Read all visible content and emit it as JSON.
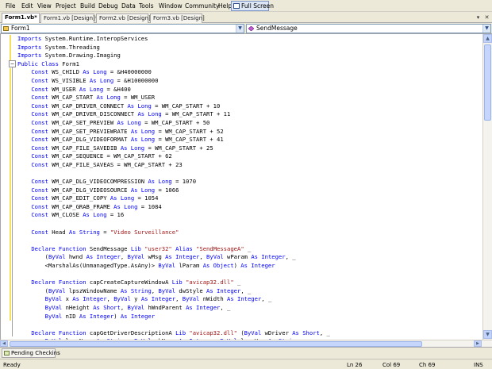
{
  "menu": [
    "File",
    "Edit",
    "View",
    "Project",
    "Build",
    "Debug",
    "Data",
    "Tools",
    "Window",
    "Community",
    "Help"
  ],
  "fullscreen_label": "Full Screen",
  "tabs": [
    {
      "label": "Form1.vb*",
      "active": true
    },
    {
      "label": "Form1.vb [Design]*",
      "active": false
    },
    {
      "label": "Form2.vb [Design]",
      "active": false
    },
    {
      "label": "Form3.vb [Design]",
      "active": false
    }
  ],
  "tab_controls": {
    "dropdown": "▾",
    "close": "✕"
  },
  "nav": {
    "class_combo": "Form1",
    "member_combo": "SendMessage"
  },
  "code_lines": [
    [
      [
        "kw",
        "Imports "
      ],
      [
        "pl",
        "System.Runtime.InteropServices"
      ]
    ],
    [
      [
        "kw",
        "Imports "
      ],
      [
        "pl",
        "System.Threading"
      ]
    ],
    [
      [
        "kw",
        "Imports "
      ],
      [
        "pl",
        "System.Drawing.Imaging"
      ]
    ],
    [
      [
        "kw",
        "Public Class "
      ],
      [
        "pl",
        "Form1"
      ]
    ],
    [
      [
        "pl",
        "    "
      ],
      [
        "kw",
        "Const "
      ],
      [
        "pl",
        "WS_CHILD "
      ],
      [
        "kw",
        "As Long "
      ],
      [
        "pl",
        "= &H40000000"
      ]
    ],
    [
      [
        "pl",
        "    "
      ],
      [
        "kw",
        "Const "
      ],
      [
        "pl",
        "WS_VISIBLE "
      ],
      [
        "kw",
        "As Long "
      ],
      [
        "pl",
        "= &H10000000"
      ]
    ],
    [
      [
        "pl",
        "    "
      ],
      [
        "kw",
        "Const "
      ],
      [
        "pl",
        "WM_USER "
      ],
      [
        "kw",
        "As Long "
      ],
      [
        "pl",
        "= &H400"
      ]
    ],
    [
      [
        "pl",
        "    "
      ],
      [
        "kw",
        "Const "
      ],
      [
        "pl",
        "WM_CAP_START "
      ],
      [
        "kw",
        "As Long "
      ],
      [
        "pl",
        "= WM_USER"
      ]
    ],
    [
      [
        "pl",
        "    "
      ],
      [
        "kw",
        "Const "
      ],
      [
        "pl",
        "WM_CAP_DRIVER_CONNECT "
      ],
      [
        "kw",
        "As Long "
      ],
      [
        "pl",
        "= WM_CAP_START + 10"
      ]
    ],
    [
      [
        "pl",
        "    "
      ],
      [
        "kw",
        "Const "
      ],
      [
        "pl",
        "WM_CAP_DRIVER_DISCONNECT "
      ],
      [
        "kw",
        "As Long "
      ],
      [
        "pl",
        "= WM_CAP_START + 11"
      ]
    ],
    [
      [
        "pl",
        "    "
      ],
      [
        "kw",
        "Const "
      ],
      [
        "pl",
        "WM_CAP_SET_PREVIEW "
      ],
      [
        "kw",
        "As Long "
      ],
      [
        "pl",
        "= WM_CAP_START + 50"
      ]
    ],
    [
      [
        "pl",
        "    "
      ],
      [
        "kw",
        "Const "
      ],
      [
        "pl",
        "WM_CAP_SET_PREVIEWRATE "
      ],
      [
        "kw",
        "As Long "
      ],
      [
        "pl",
        "= WM_CAP_START + 52"
      ]
    ],
    [
      [
        "pl",
        "    "
      ],
      [
        "kw",
        "Const "
      ],
      [
        "pl",
        "WM_CAP_DLG_VIDEOFORMAT "
      ],
      [
        "kw",
        "As Long "
      ],
      [
        "pl",
        "= WM_CAP_START + 41"
      ]
    ],
    [
      [
        "pl",
        "    "
      ],
      [
        "kw",
        "Const "
      ],
      [
        "pl",
        "WM_CAP_FILE_SAVEDIB "
      ],
      [
        "kw",
        "As Long "
      ],
      [
        "pl",
        "= WM_CAP_START + 25"
      ]
    ],
    [
      [
        "pl",
        "    "
      ],
      [
        "kw",
        "Const "
      ],
      [
        "pl",
        "WM_CAP_SEQUENCE "
      ],
      [
        "pl",
        "= WM_CAP_START + 62"
      ]
    ],
    [
      [
        "pl",
        "    "
      ],
      [
        "kw",
        "Const "
      ],
      [
        "pl",
        "WM_CAP_FILE_SAVEAS "
      ],
      [
        "pl",
        "= WM_CAP_START + 23"
      ]
    ],
    [
      [
        "pl",
        ""
      ]
    ],
    [
      [
        "pl",
        "    "
      ],
      [
        "kw",
        "Const "
      ],
      [
        "pl",
        "WM_CAP_DLG_VIDEOCOMPRESSION "
      ],
      [
        "kw",
        "As Long "
      ],
      [
        "pl",
        "= 1070"
      ]
    ],
    [
      [
        "pl",
        "    "
      ],
      [
        "kw",
        "Const "
      ],
      [
        "pl",
        "WM_CAP_DLG_VIDEOSOURCE "
      ],
      [
        "kw",
        "As Long "
      ],
      [
        "pl",
        "= 1066"
      ]
    ],
    [
      [
        "pl",
        "    "
      ],
      [
        "kw",
        "Const "
      ],
      [
        "pl",
        "WM_CAP_EDIT_COPY "
      ],
      [
        "kw",
        "As Long "
      ],
      [
        "pl",
        "= 1054"
      ]
    ],
    [
      [
        "pl",
        "    "
      ],
      [
        "kw",
        "Const "
      ],
      [
        "pl",
        "WM_CAP_GRAB_FRAME "
      ],
      [
        "kw",
        "As Long "
      ],
      [
        "pl",
        "= 1084"
      ]
    ],
    [
      [
        "pl",
        "    "
      ],
      [
        "kw",
        "Const "
      ],
      [
        "pl",
        "WM_CLOSE "
      ],
      [
        "kw",
        "As Long "
      ],
      [
        "pl",
        "= 16"
      ]
    ],
    [
      [
        "pl",
        ""
      ]
    ],
    [
      [
        "pl",
        "    "
      ],
      [
        "kw",
        "Const "
      ],
      [
        "pl",
        "Head "
      ],
      [
        "kw",
        "As String "
      ],
      [
        "pl",
        "= "
      ],
      [
        "str",
        "\"Video Surveillance\""
      ]
    ],
    [
      [
        "pl",
        ""
      ]
    ],
    [
      [
        "pl",
        "    "
      ],
      [
        "kw",
        "Declare Function "
      ],
      [
        "pl",
        "SendMessage "
      ],
      [
        "kw",
        "Lib "
      ],
      [
        "str",
        "\"user32\" "
      ],
      [
        "kw",
        "Alias "
      ],
      [
        "str",
        "\"SendMessageA\" "
      ],
      [
        "pl",
        "_"
      ]
    ],
    [
      [
        "pl",
        "        ("
      ],
      [
        "kw",
        "ByVal "
      ],
      [
        "pl",
        "hwnd "
      ],
      [
        "kw",
        "As Integer"
      ],
      [
        "pl",
        ", "
      ],
      [
        "kw",
        "ByVal "
      ],
      [
        "pl",
        "wMsg "
      ],
      [
        "kw",
        "As Integer"
      ],
      [
        "pl",
        ", "
      ],
      [
        "kw",
        "ByVal "
      ],
      [
        "pl",
        "wParam "
      ],
      [
        "kw",
        "As Integer"
      ],
      [
        "pl",
        ", _"
      ]
    ],
    [
      [
        "pl",
        "        <MarshalAs(UnmanagedType.AsAny)> "
      ],
      [
        "kw",
        "ByVal "
      ],
      [
        "pl",
        "lParam "
      ],
      [
        "kw",
        "As Object"
      ],
      [
        "pl",
        ") "
      ],
      [
        "kw",
        "As Integer"
      ]
    ],
    [
      [
        "pl",
        ""
      ]
    ],
    [
      [
        "pl",
        "    "
      ],
      [
        "kw",
        "Declare Function "
      ],
      [
        "pl",
        "capCreateCaptureWindowA "
      ],
      [
        "kw",
        "Lib "
      ],
      [
        "str",
        "\"avicap32.dll\" "
      ],
      [
        "pl",
        "_"
      ]
    ],
    [
      [
        "pl",
        "        ("
      ],
      [
        "kw",
        "ByVal "
      ],
      [
        "pl",
        "lpszWindowName "
      ],
      [
        "kw",
        "As String"
      ],
      [
        "pl",
        ", "
      ],
      [
        "kw",
        "ByVal "
      ],
      [
        "pl",
        "dwStyle "
      ],
      [
        "kw",
        "As Integer"
      ],
      [
        "pl",
        ", _"
      ]
    ],
    [
      [
        "pl",
        "        "
      ],
      [
        "kw",
        "ByVal "
      ],
      [
        "pl",
        "x "
      ],
      [
        "kw",
        "As Integer"
      ],
      [
        "pl",
        ", "
      ],
      [
        "kw",
        "ByVal "
      ],
      [
        "pl",
        "y "
      ],
      [
        "kw",
        "As Integer"
      ],
      [
        "pl",
        ", "
      ],
      [
        "kw",
        "ByVal "
      ],
      [
        "pl",
        "nWidth "
      ],
      [
        "kw",
        "As Integer"
      ],
      [
        "pl",
        ", _"
      ]
    ],
    [
      [
        "pl",
        "        "
      ],
      [
        "kw",
        "ByVal "
      ],
      [
        "pl",
        "nHeight "
      ],
      [
        "kw",
        "As Short"
      ],
      [
        "pl",
        ", "
      ],
      [
        "kw",
        "ByVal "
      ],
      [
        "pl",
        "hWndParent "
      ],
      [
        "kw",
        "As Integer"
      ],
      [
        "pl",
        ", _"
      ]
    ],
    [
      [
        "pl",
        "        "
      ],
      [
        "kw",
        "ByVal "
      ],
      [
        "pl",
        "nID "
      ],
      [
        "kw",
        "As Integer"
      ],
      [
        "pl",
        ") "
      ],
      [
        "kw",
        "As Integer"
      ]
    ],
    [
      [
        "pl",
        ""
      ]
    ],
    [
      [
        "pl",
        "    "
      ],
      [
        "kw",
        "Declare Function "
      ],
      [
        "pl",
        "capGetDriverDescriptionA "
      ],
      [
        "kw",
        "Lib "
      ],
      [
        "str",
        "\"avicap32.dll\" "
      ],
      [
        "pl",
        "("
      ],
      [
        "kw",
        "ByVal "
      ],
      [
        "pl",
        "wDriver "
      ],
      [
        "kw",
        "As Short"
      ],
      [
        "pl",
        ", _"
      ]
    ],
    [
      [
        "pl",
        "        "
      ],
      [
        "kw",
        "ByVal "
      ],
      [
        "pl",
        "lpszName "
      ],
      [
        "kw",
        "As String"
      ],
      [
        "pl",
        ", "
      ],
      [
        "kw",
        "ByVal "
      ],
      [
        "pl",
        "cbName "
      ],
      [
        "kw",
        "As Integer"
      ],
      [
        "pl",
        ", "
      ],
      [
        "kw",
        "ByVal "
      ],
      [
        "pl",
        "lpszVer "
      ],
      [
        "kw",
        "As String"
      ],
      [
        "pl",
        ", _"
      ]
    ]
  ],
  "colors": {
    "keyword": "#0000ff",
    "string": "#a31515",
    "plain": "#000000",
    "change_margin": "#f5e05a"
  },
  "tool_window_tab": "Pending Checkins",
  "status": {
    "text": "Ready",
    "line": "Ln 26",
    "col": "Col 69",
    "ch": "Ch 69",
    "mode": "INS"
  }
}
